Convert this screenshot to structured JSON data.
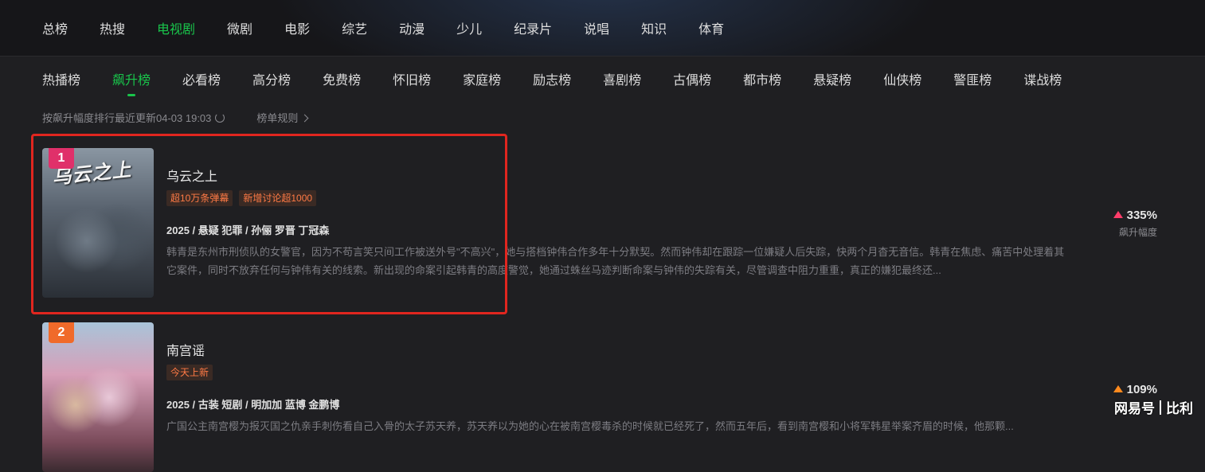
{
  "categories": [
    "总榜",
    "热搜",
    "电视剧",
    "微剧",
    "电影",
    "综艺",
    "动漫",
    "少儿",
    "纪录片",
    "说唱",
    "知识",
    "体育"
  ],
  "categories_active": "电视剧",
  "subtabs": [
    "热播榜",
    "飙升榜",
    "必看榜",
    "高分榜",
    "免费榜",
    "怀旧榜",
    "家庭榜",
    "励志榜",
    "喜剧榜",
    "古偶榜",
    "都市榜",
    "悬疑榜",
    "仙侠榜",
    "警匪榜",
    "谍战榜"
  ],
  "subtabs_active": "飙升榜",
  "info": {
    "update_text": "按飙升幅度排行最近更新04-03 19:03",
    "rules_link": "榜单规则"
  },
  "items": [
    {
      "rank": "1",
      "poster_text": "乌云之上",
      "title": "乌云之上",
      "tags": [
        "超10万条弹幕",
        "新增讨论超1000"
      ],
      "meta": "2025 / 悬疑 犯罪 / 孙俪 罗晋 丁冠森",
      "desc": "韩青是东州市刑侦队的女警官，因为不苟言笑只间工作被送外号\"不高兴\"，她与搭档钟伟合作多年十分默契。然而钟伟却在跟踪一位嫌疑人后失踪，快两个月杳无音信。韩青在焦虑、痛苦中处理着其它案件，同时不放弃任何与钟伟有关的线索。新出现的命案引起韩青的高度警觉，她通过蛛丝马迹判断命案与钟伟的失踪有关，尽管调查中阻力重重，真正的嫌犯最终还...",
      "rise_value": "335%",
      "rise_label": "飙升幅度",
      "rise_color": "#ff3d6a"
    },
    {
      "rank": "2",
      "poster_text": "",
      "title": "南宫谣",
      "tags": [
        "今天上新"
      ],
      "meta": "2025 / 古装 短剧 / 明加加 蓝博 金鹏博",
      "desc": "广国公主南宫樱为报灭国之仇亲手刺伤看自己入骨的太子苏天养，苏天养以为她的心在被南宫樱毒杀的时候就已经死了，然而五年后，看到南宫樱和小将军韩星举案齐眉的时候，他那颗...",
      "rise_value": "109%",
      "rise_label": "",
      "rise_color": "#ff8a1e"
    }
  ],
  "watermark": {
    "left": "网易号",
    "right": "比利"
  }
}
